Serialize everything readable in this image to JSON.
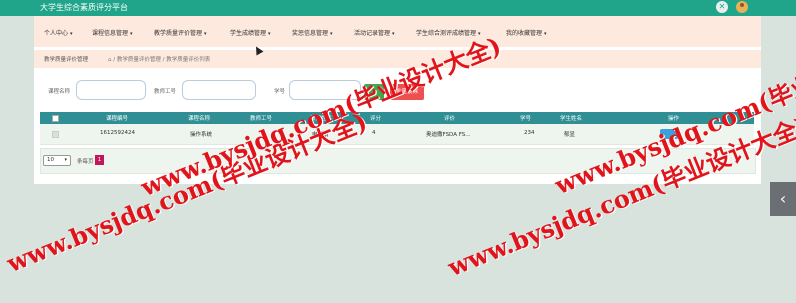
{
  "app": {
    "title": "大学生综合素质评分平台",
    "close_glyph": "✕"
  },
  "nav": {
    "items": [
      {
        "label": "个人中心"
      },
      {
        "label": "课程信息管理"
      },
      {
        "label": "教学质量评价管理"
      },
      {
        "label": "学生成绩管理"
      },
      {
        "label": "奖惩信息管理"
      },
      {
        "label": "活动记录管理"
      },
      {
        "label": "学生综合测评成绩管理"
      },
      {
        "label": "我的收藏管理"
      }
    ],
    "caret": "▾"
  },
  "breadcrumb": {
    "page": "教学质量评价管理",
    "path": "⌂ / 教学质量评价管理 / 教学质量评价列表"
  },
  "search": {
    "course_name_label": "课程名称",
    "teacher_no_label": "教师工号",
    "student_no_label": "学号",
    "batch_delete_label": "批量删除"
  },
  "table": {
    "headers": [
      "课程编号",
      "课程名称",
      "教师工号",
      "教师姓名",
      "评分",
      "评价",
      "学号",
      "学生姓名",
      "操作"
    ],
    "rows": [
      [
        "1612592424",
        "操作系统",
        "",
        "电风扇",
        "4",
        "奥迪撒FSDA FS...",
        "234",
        "郁显",
        ""
      ]
    ]
  },
  "pager": {
    "page_size": "10",
    "total": "条每页",
    "current_page": "1"
  },
  "side": {
    "arrow_glyph": "‹"
  },
  "watermark": {
    "text": "www.bysjdq.com(毕业设计大全)"
  }
}
